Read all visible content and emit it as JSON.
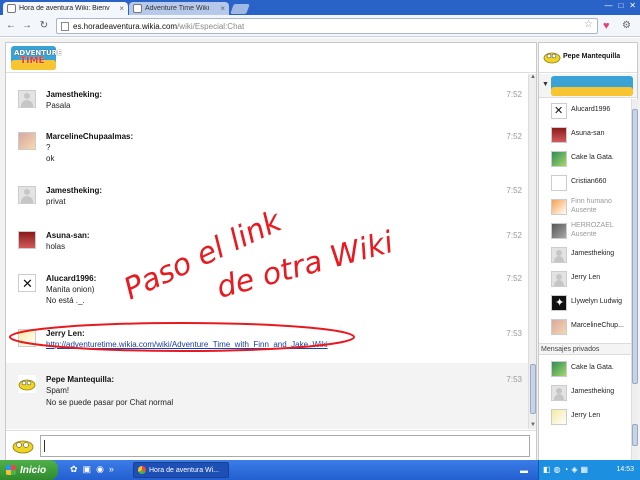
{
  "browser": {
    "tabs": [
      {
        "title": "Hora de aventura Wiki: Bienv",
        "active": true
      },
      {
        "title": "Adventure Time Wiki",
        "active": false
      }
    ],
    "url_host": "es.horadeaventura.wikia.com",
    "url_path": "/wiki/Especial:Chat",
    "icons": {
      "back": "back-arrow-icon",
      "forward": "forward-arrow-icon",
      "reload": "reload-icon",
      "star": "star-icon",
      "heart": "heart-icon",
      "wrench": "wrench-icon"
    }
  },
  "wiki": {
    "logo_line1": "ADVENTURE",
    "logo_line2": "TIME"
  },
  "messages": [
    {
      "user": "Jamestheking:",
      "lines": [
        "Pasala"
      ],
      "time": "7:52"
    },
    {
      "user": "MarcelineChupaalmas:",
      "lines": [
        "?",
        "ok"
      ],
      "time": "7:52"
    },
    {
      "user": "Jamestheking:",
      "lines": [
        "privat"
      ],
      "time": "7:52"
    },
    {
      "user": "Asuna-san:",
      "lines": [
        "holas"
      ],
      "time": "7:52"
    },
    {
      "user": "Alucard1996:",
      "lines": [
        "Manita onion)",
        "No está ._."
      ],
      "time": "7:52"
    },
    {
      "user": "Jerry Len:",
      "lines": [
        "http://adventuretime.wikia.com/wiki/Adventure_Time_with_Finn_and_Jake_Wiki"
      ],
      "time": "7:53"
    },
    {
      "user": "Pepe Mantequilla:",
      "lines": [
        "Spam!",
        "No se puede pasar por Chat normal"
      ],
      "time": "7:53"
    }
  ],
  "annotation": {
    "line1": "Paso el link",
    "line2": "de otra Wiki",
    "color": "#e8191f"
  },
  "sidebar": {
    "me": "Pepe Mantequilla",
    "users": [
      {
        "name": "Alucard1996"
      },
      {
        "name": "Asuna-san"
      },
      {
        "name": "Cake la Gata."
      },
      {
        "name": "Cristian660"
      },
      {
        "name": "Finn humano",
        "status": "Ausente",
        "starred": true
      },
      {
        "name": "HERROZAEL",
        "status": "Ausente"
      },
      {
        "name": "Jamestheking"
      },
      {
        "name": "Jerry Len"
      },
      {
        "name": "Llywelyn Ludwig"
      },
      {
        "name": "MarcelineChup..."
      }
    ],
    "private_header": "Mensajes privados",
    "private_users": [
      {
        "name": "Cake la Gata."
      },
      {
        "name": "Jamestheking"
      },
      {
        "name": "Jerry Len"
      }
    ]
  },
  "taskbar": {
    "start_label": "Inicio",
    "task_label": "Hora de aventura Wi...",
    "clock": "14:53"
  }
}
